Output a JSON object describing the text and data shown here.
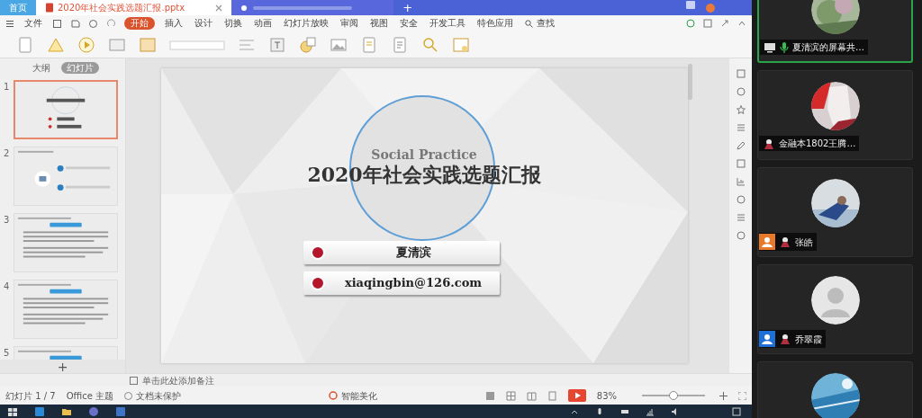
{
  "browser_tabs": [
    {
      "label": "首页",
      "selected": false
    },
    {
      "label": "2020年社会实践选题汇报.pptx",
      "selected": true
    }
  ],
  "new_tab": "+",
  "menu": {
    "file": "文件",
    "tabs": [
      {
        "label": "开始",
        "selected": true
      },
      {
        "label": "插入",
        "selected": false
      },
      {
        "label": "设计",
        "selected": false
      },
      {
        "label": "切换",
        "selected": false
      },
      {
        "label": "动画",
        "selected": false
      },
      {
        "label": "幻灯片放映",
        "selected": false
      },
      {
        "label": "审阅",
        "selected": false
      },
      {
        "label": "视图",
        "selected": false
      },
      {
        "label": "安全",
        "selected": false
      },
      {
        "label": "开发工具",
        "selected": false
      },
      {
        "label": "特色应用",
        "selected": false
      }
    ],
    "search": "查找"
  },
  "panel_tabs": [
    {
      "label": "大纲",
      "selected": false
    },
    {
      "label": "幻灯片",
      "selected": true
    }
  ],
  "thumbnails": [
    {
      "number": "1",
      "selected": true,
      "kind": "title"
    },
    {
      "number": "2",
      "selected": false,
      "kind": "diagram"
    },
    {
      "number": "3",
      "selected": false,
      "kind": "text"
    },
    {
      "number": "4",
      "selected": false,
      "kind": "text"
    },
    {
      "number": "5",
      "selected": false,
      "kind": "text"
    }
  ],
  "add_slide": "+",
  "slide": {
    "subtitle": "Social Practice",
    "title": "2020年社会实践选题汇报",
    "info": [
      "夏清滨",
      "xiaqingbin@126.com"
    ]
  },
  "notes_placeholder": "单击此处添加备注",
  "status_bar": {
    "slide_counter": "幻灯片 1 / 7",
    "theme": "Office 主题",
    "protection": "文档未保护",
    "beautify": "智能美化",
    "zoom": "83%",
    "zoom_slider": {
      "level": 0.5
    }
  },
  "participants": [
    {
      "name": "夏清滨的屏幕共…",
      "speaking": true,
      "sharing": true,
      "kind": "picture"
    },
    {
      "name": "金融本1802王腾…",
      "speaking": false,
      "sharing": false,
      "kind": "picture"
    },
    {
      "name": "张皓",
      "speaking": false,
      "sharing": false,
      "kind": "picture",
      "color": "#e8782a"
    },
    {
      "name": "乔翠霞",
      "speaking": false,
      "sharing": false,
      "kind": "default",
      "color": "#1f6fd8"
    },
    {
      "speaking": false,
      "kind": "picture"
    }
  ]
}
